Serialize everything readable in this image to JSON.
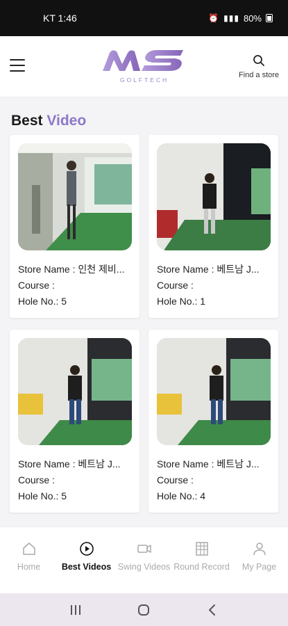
{
  "status_bar": {
    "carrier_time": "KT 1:46",
    "battery": "80%"
  },
  "header": {
    "logo_text": "GOLFTECH",
    "find_store_label": "Find a store"
  },
  "section": {
    "title_main": "Best",
    "title_accent": "Video",
    "accent_color": "#8e78c8"
  },
  "videos": [
    {
      "store_name": "Store Name : 인천 제비...",
      "course": "Course :",
      "hole": "Hole No.: 5"
    },
    {
      "store_name": "Store Name : 베트남 J...",
      "course": "Course :",
      "hole": "Hole No.: 1"
    },
    {
      "store_name": "Store Name : 베트남 J...",
      "course": "Course :",
      "hole": "Hole No.: 5"
    },
    {
      "store_name": "Store Name : 베트남 J...",
      "course": "Course :",
      "hole": "Hole No.: 4"
    }
  ],
  "bottom_nav": {
    "items": [
      {
        "label": "Home",
        "icon": "home-icon"
      },
      {
        "label": "Best Videos",
        "icon": "play-circle-icon",
        "active": true
      },
      {
        "label": "Swing Videos",
        "icon": "video-camera-icon"
      },
      {
        "label": "Round Record",
        "icon": "scorecard-icon"
      },
      {
        "label": "My Page",
        "icon": "user-icon"
      }
    ]
  }
}
